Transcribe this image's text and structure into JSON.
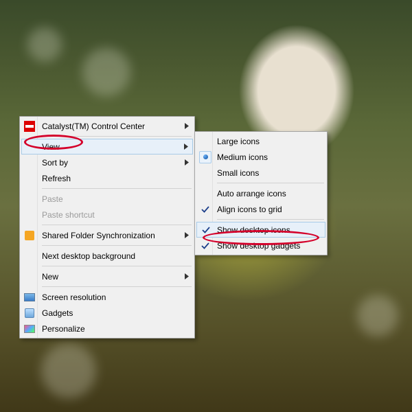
{
  "main_menu": {
    "items": [
      {
        "label": "Catalyst(TM) Control Center",
        "submenu": true
      },
      {
        "label": "View",
        "submenu": true,
        "highlighted": true,
        "circled": true
      },
      {
        "label": "Sort by",
        "submenu": true
      },
      {
        "label": "Refresh"
      },
      {
        "label": "Paste",
        "disabled": true
      },
      {
        "label": "Paste shortcut",
        "disabled": true
      },
      {
        "label": "Shared Folder Synchronization",
        "submenu": true
      },
      {
        "label": "Next desktop background"
      },
      {
        "label": "New",
        "submenu": true
      },
      {
        "label": "Screen resolution"
      },
      {
        "label": "Gadgets"
      },
      {
        "label": "Personalize"
      }
    ]
  },
  "view_submenu": {
    "items": [
      {
        "label": "Large icons"
      },
      {
        "label": "Medium icons",
        "radio": true
      },
      {
        "label": "Small icons"
      },
      {
        "label": "Auto arrange icons"
      },
      {
        "label": "Align icons to grid",
        "checked": true
      },
      {
        "label": "Show desktop icons",
        "checked": true,
        "highlighted": true,
        "circled": true
      },
      {
        "label": "Show desktop gadgets",
        "checked": true
      }
    ]
  },
  "colors": {
    "annotation_red": "#d4002a"
  }
}
